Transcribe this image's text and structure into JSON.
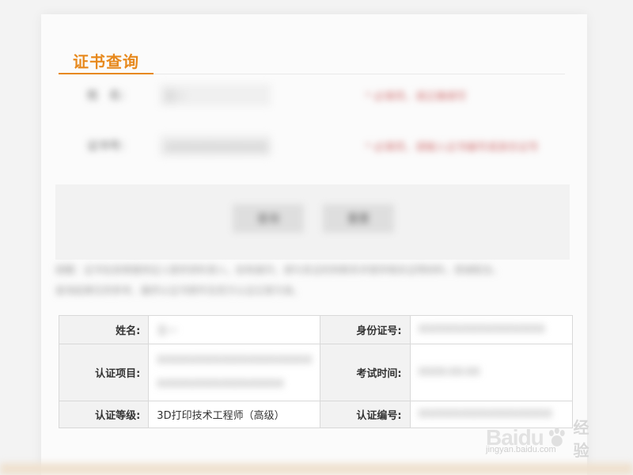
{
  "header": {
    "title": "证书查询"
  },
  "form": {
    "rows": [
      {
        "label": "姓　名：",
        "value": "王一",
        "hint": "* 必填项，请正确填写"
      },
      {
        "label": "证书号：",
        "value": "XXXXXXXXXXXXXXXX",
        "hint": "* 必填项，请输入证书编号或身份证号"
      }
    ]
  },
  "buttons": {
    "query_label": "查询",
    "reset_label": "重置"
  },
  "notice": {
    "line1": "提醒：证书信息根据持证人提供资料录入，如有疑问，请与发证机构联系并提供相关证明材料，感谢配合。",
    "line2": "查询结果仅供参考，最终以证书原件及官方认证记录为准。"
  },
  "result": {
    "name_label": "姓名:",
    "name_value": "王一",
    "id_label": "身份证号:",
    "id_value": "XXXXXXXXXXXXXXXXXX",
    "project_label": "认证项目:",
    "project_value_1": "XXXXXXXXXXXXXXXXXXXXXX",
    "project_value_2": "XXXXXXXXXXXXXXXXXX",
    "exam_time_label": "考试时间:",
    "exam_time_value": "XXXX-XX-XX",
    "level_label": "认证等级:",
    "level_value": "3D打印技术工程师（高级）",
    "cert_no_label": "认证编号:",
    "cert_no_value": "XXXXXXXXXXXXXXXXXXX"
  },
  "watermark": {
    "brand": "Baidu",
    "cn": "经验",
    "url": "jingyan.baidu.com"
  },
  "colors": {
    "accent": "#e7891d",
    "hint": "#d07373"
  }
}
